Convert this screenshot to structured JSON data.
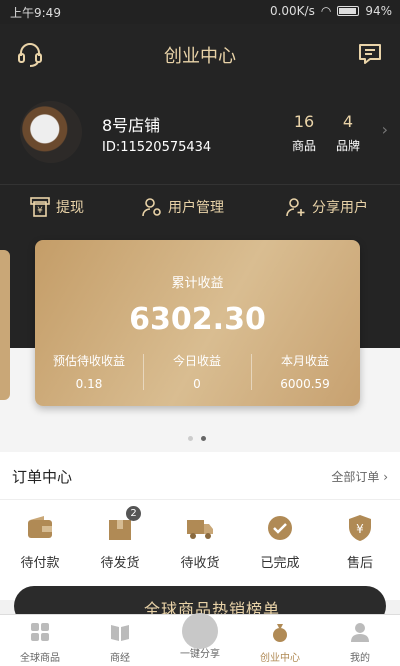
{
  "status": {
    "time": "上午9:49",
    "net": "0.00K/s",
    "battery": "94%"
  },
  "header": {
    "title": "创业中心"
  },
  "profile": {
    "shop_name": "8号店铺",
    "shop_id": "ID:11520575434",
    "stats": [
      {
        "num": "16",
        "label": "商品"
      },
      {
        "num": "4",
        "label": "品牌"
      }
    ]
  },
  "actions": [
    {
      "label": "提现",
      "icon": "withdraw-icon"
    },
    {
      "label": "用户管理",
      "icon": "user-settings-icon"
    },
    {
      "label": "分享用户",
      "icon": "add-user-icon"
    }
  ],
  "earnings": {
    "label": "累计收益",
    "amount": "6302.30",
    "items": [
      {
        "label": "预估待收收益",
        "value": "0.18"
      },
      {
        "label": "今日收益",
        "value": "0"
      },
      {
        "label": "本月收益",
        "value": "6000.59"
      }
    ]
  },
  "orders": {
    "title": "订单中心",
    "all_label": "全部订单",
    "items": [
      {
        "label": "待付款"
      },
      {
        "label": "待发货",
        "badge": "2"
      },
      {
        "label": "待收货"
      },
      {
        "label": "已完成"
      },
      {
        "label": "售后"
      }
    ]
  },
  "promo": {
    "text": "全球商品热销榜单"
  },
  "tabs": [
    {
      "label": "全球商品"
    },
    {
      "label": "商经"
    },
    {
      "label": "一键分享"
    },
    {
      "label": "创业中心"
    },
    {
      "label": "我的"
    }
  ],
  "colors": {
    "accent": "#e9d3a8",
    "gold": "#c49d68",
    "dark": "#242424",
    "icon": "#b08a55"
  }
}
